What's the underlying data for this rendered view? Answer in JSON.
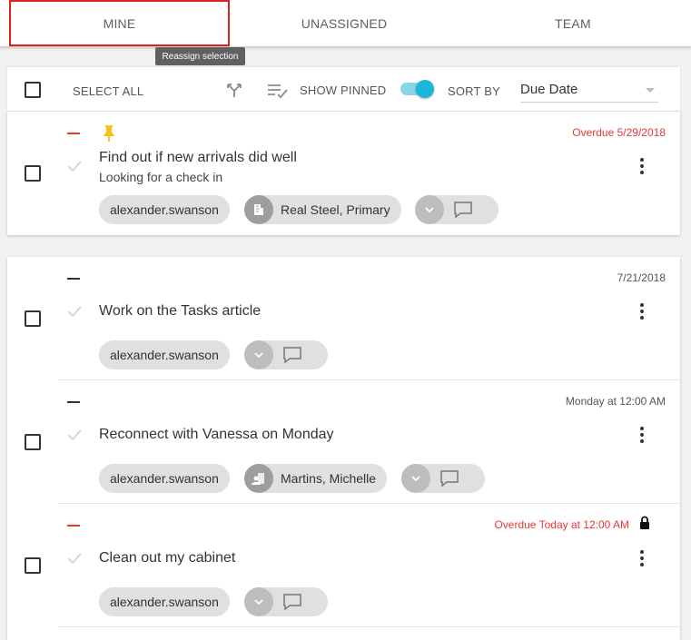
{
  "tabs": [
    {
      "label": "MINE",
      "active": true
    },
    {
      "label": "UNASSIGNED",
      "active": false
    },
    {
      "label": "TEAM",
      "active": false
    }
  ],
  "tooltip": "Reassign selection",
  "toolbar": {
    "select_all_label": "SELECT ALL",
    "show_pinned_label": "SHOW PINNED",
    "show_pinned_on": true,
    "sort_by_label": "SORT BY",
    "sort_value": "Due Date"
  },
  "tasks": [
    {
      "title": "Find out if new arrivals did well",
      "subtitle": "Looking for a check in",
      "date": "Overdue 5/29/2018",
      "owner": "alexander.swanson",
      "linked": "Real Steel, Primary"
    },
    {
      "title": "Work on the Tasks article",
      "date": "7/21/2018",
      "owner": "alexander.swanson"
    },
    {
      "title": "Reconnect with Vanessa on Monday",
      "date": "Monday at 12:00 AM",
      "owner": "alexander.swanson",
      "linked": "Martins, Michelle"
    },
    {
      "title": "Clean out my cabinet",
      "date": "Overdue Today at 12:00 AM",
      "owner": "alexander.swanson"
    }
  ],
  "colors": {
    "accent": "#1cb7d6",
    "overdue": "#e53935",
    "pin": "#f6c21c",
    "active_tab_border": "#e02020"
  }
}
